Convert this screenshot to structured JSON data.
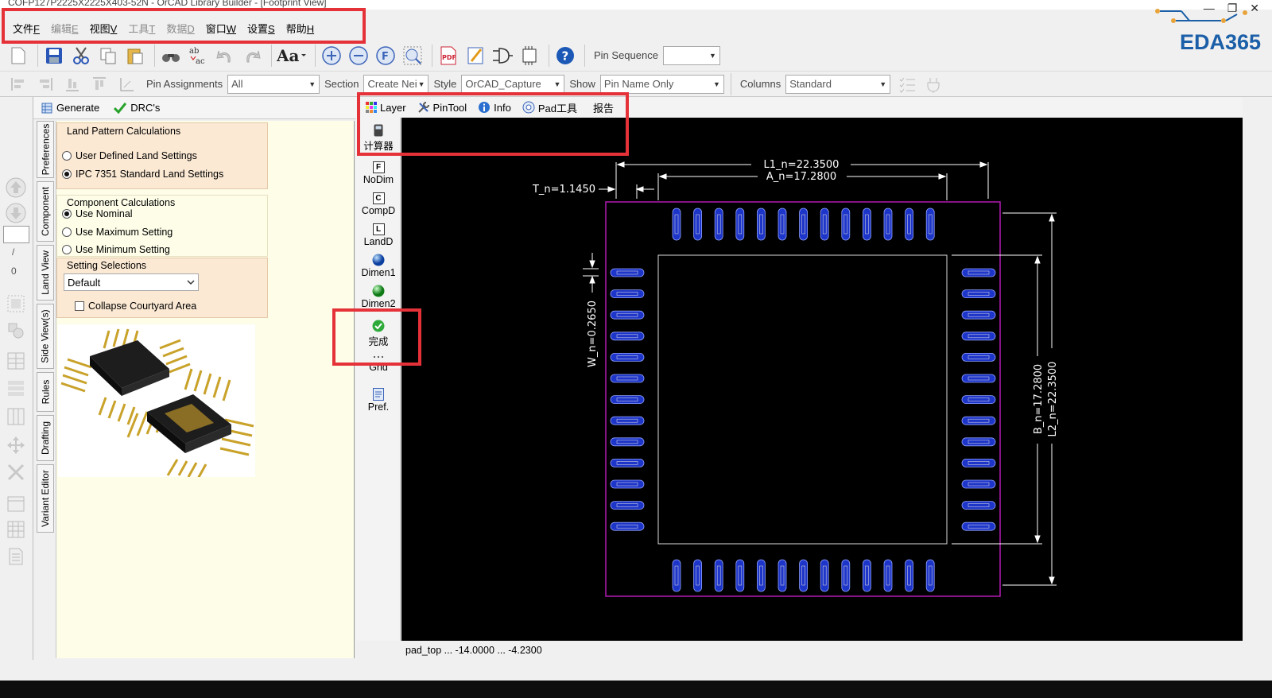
{
  "window": {
    "title": "COFP127P2225X2225X403-52N - OrCAD Library Builder - [Footprint View]",
    "controls": [
      "—",
      "❐",
      "✕"
    ]
  },
  "brand": {
    "text": "EDA365"
  },
  "menu": [
    {
      "label": "文件",
      "acc": "F",
      "enabled": true
    },
    {
      "label": "编辑",
      "acc": "E",
      "enabled": false
    },
    {
      "label": "视图",
      "acc": "V",
      "enabled": true
    },
    {
      "label": "工具",
      "acc": "T",
      "enabled": false
    },
    {
      "label": "数据",
      "acc": "D",
      "enabled": false
    },
    {
      "label": "窗口",
      "acc": "W",
      "enabled": true
    },
    {
      "label": "设置",
      "acc": "S",
      "enabled": true
    },
    {
      "label": "帮助",
      "acc": "H",
      "enabled": true
    }
  ],
  "toolbar1": {
    "pin_sequence_label": "Pin Sequence",
    "pin_sequence_value": ""
  },
  "toolbar2": {
    "pin_assignments_label": "Pin Assignments",
    "pin_assignments_value": "All",
    "section_label": "Section",
    "section_value": "Create Nei",
    "style_label": "Style",
    "style_value": "OrCAD_Capture",
    "show_label": "Show",
    "show_value": "Pin Name Only",
    "columns_label": "Columns",
    "columns_value": "Standard"
  },
  "left_tools": {
    "field_value": "",
    "slash": "/",
    "zero": "0"
  },
  "panel": {
    "generate_label": "Generate",
    "drcs_label": "DRC's",
    "vtabs": [
      "Preferences",
      "Component",
      "Land View",
      "Side View(s)",
      "Rules",
      "Drafting",
      "Variant Editor"
    ],
    "land_pattern": {
      "title": "Land Pattern Calculations",
      "options": [
        {
          "label": "User Defined Land Settings",
          "selected": false
        },
        {
          "label": "IPC 7351 Standard Land Settings",
          "selected": true
        }
      ]
    },
    "component_calc": {
      "title": "Component Calculations",
      "options": [
        {
          "label": "Use Nominal",
          "selected": true
        },
        {
          "label": "Use Maximum Setting",
          "selected": false
        },
        {
          "label": "Use Minimum Setting",
          "selected": false
        }
      ]
    },
    "setting_selections": {
      "title": "Setting Selections",
      "value": "Default",
      "collapse_label": "Collapse Courtyard Area",
      "collapse_checked": false
    }
  },
  "canvas_tabs": [
    "Layer",
    "PinTool",
    "Info",
    "Pad工具",
    "报告",
    "计算器"
  ],
  "canvas_tools": [
    "NoDim",
    "CompD",
    "LandD",
    "Dimen1",
    "Dimen2",
    "完成",
    "Grid",
    "Pref."
  ],
  "canvas_tool_letters": {
    "NoDim": "F",
    "CompD": "C",
    "LandD": "L"
  },
  "footprint": {
    "dim_l1": "L1_n=22.3500",
    "dim_a": "A_n=17.2800",
    "dim_t": "T_n=1.1450",
    "dim_w": "W_n=0.2650",
    "dim_b": "B_n=17.2800",
    "dim_l2": "L2_n=22.3500",
    "pins_per_side": 13
  },
  "status": {
    "text": "pad_top ... -14.0000 ... -4.2300"
  },
  "colors": {
    "highlight": "#e53238",
    "pad": "#1d35c9",
    "outline": "#b01ab0",
    "brand": "#1a5fa8"
  }
}
